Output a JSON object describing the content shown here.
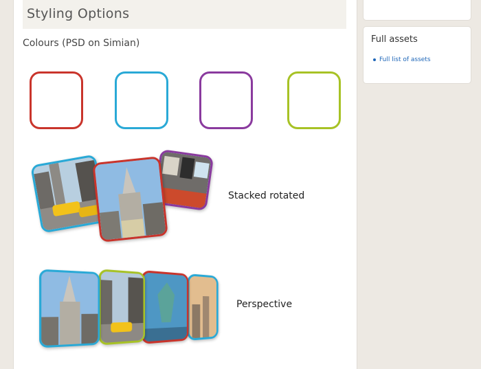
{
  "section": {
    "title": "Styling Options"
  },
  "colours": {
    "heading": "Colours (PSD on Simian)",
    "swatches": [
      {
        "name": "red",
        "color": "#c9342b"
      },
      {
        "name": "blue",
        "color": "#29a9d6"
      },
      {
        "name": "purple",
        "color": "#8a3a9e"
      },
      {
        "name": "green",
        "color": "#a7c225"
      }
    ]
  },
  "stacked": {
    "caption": "Stacked rotated"
  },
  "perspective": {
    "caption": "Perspective"
  },
  "sidebar": {
    "full_assets_title": "Full assets",
    "links": [
      "Full list of assets"
    ]
  }
}
